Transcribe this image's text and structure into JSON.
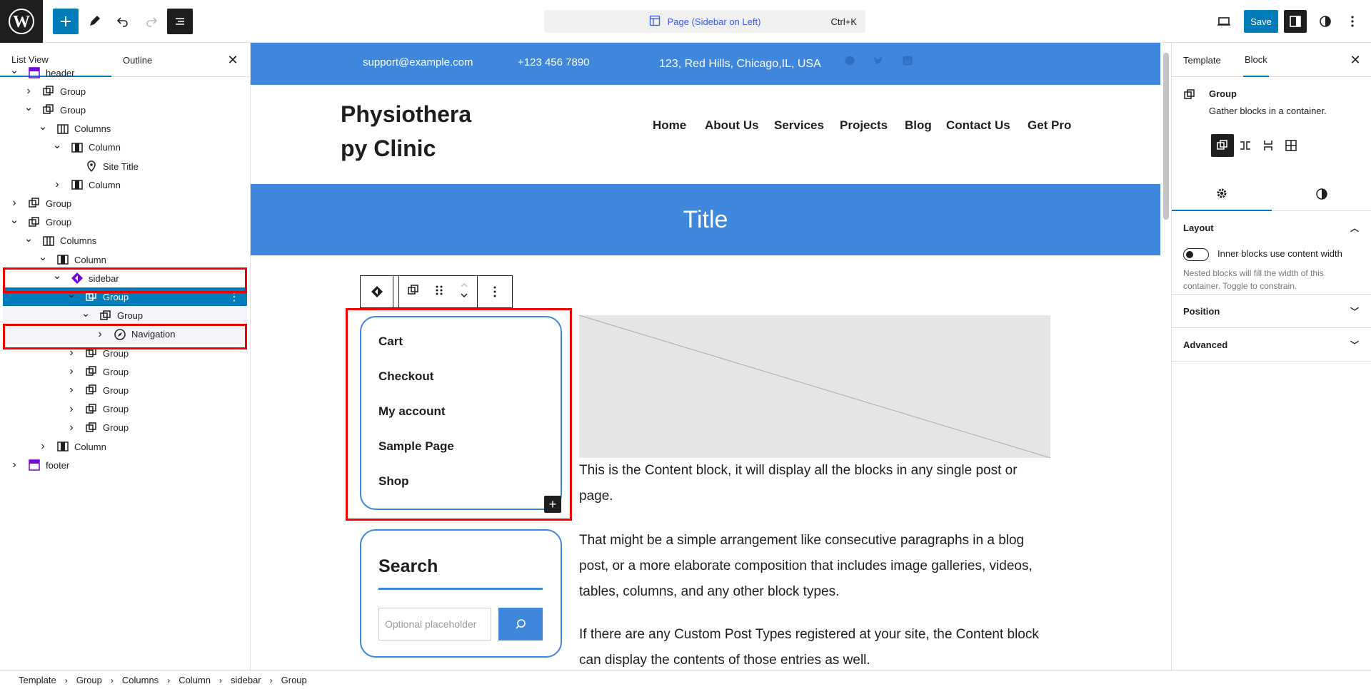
{
  "topbar": {
    "doc_title": "Page (Sidebar on Left)",
    "shortcut": "Ctrl+K",
    "save_label": "Save"
  },
  "left_panel": {
    "tabs": [
      "List View",
      "Outline"
    ],
    "tree": [
      {
        "label": "header",
        "depth": 0,
        "expanded": true,
        "icon": "template-part-icon"
      },
      {
        "label": "Group",
        "depth": 1,
        "expanded": false,
        "icon": "group-icon"
      },
      {
        "label": "Group",
        "depth": 1,
        "expanded": true,
        "icon": "group-icon"
      },
      {
        "label": "Columns",
        "depth": 2,
        "expanded": true,
        "icon": "columns-icon"
      },
      {
        "label": "Column",
        "depth": 3,
        "expanded": true,
        "icon": "column-icon"
      },
      {
        "label": "Site Title",
        "depth": 4,
        "expanded": null,
        "icon": "map-pin-icon"
      },
      {
        "label": "Column",
        "depth": 3,
        "expanded": false,
        "icon": "column-icon"
      },
      {
        "label": "Group",
        "depth": 0,
        "expanded": false,
        "icon": "group-icon"
      },
      {
        "label": "Group",
        "depth": 0,
        "expanded": true,
        "icon": "group-icon"
      },
      {
        "label": "Columns",
        "depth": 1,
        "expanded": true,
        "icon": "columns-icon"
      },
      {
        "label": "Column",
        "depth": 2,
        "expanded": true,
        "icon": "column-icon"
      },
      {
        "label": "sidebar",
        "depth": 3,
        "expanded": true,
        "icon": "synced-pattern-icon"
      },
      {
        "label": "Group",
        "depth": 4,
        "expanded": true,
        "icon": "group-icon"
      },
      {
        "label": "Group",
        "depth": 5,
        "expanded": true,
        "icon": "group-icon"
      },
      {
        "label": "Navigation",
        "depth": 6,
        "expanded": false,
        "icon": "compass-icon"
      },
      {
        "label": "Group",
        "depth": 4,
        "expanded": false,
        "icon": "group-icon"
      },
      {
        "label": "Group",
        "depth": 4,
        "expanded": false,
        "icon": "group-icon"
      },
      {
        "label": "Group",
        "depth": 4,
        "expanded": false,
        "icon": "group-icon"
      },
      {
        "label": "Group",
        "depth": 4,
        "expanded": false,
        "icon": "group-icon"
      },
      {
        "label": "Group",
        "depth": 4,
        "expanded": false,
        "icon": "group-icon"
      },
      {
        "label": "Column",
        "depth": 2,
        "expanded": false,
        "icon": "column-icon"
      },
      {
        "label": "footer",
        "depth": 0,
        "expanded": false,
        "icon": "template-part-icon"
      }
    ]
  },
  "canvas": {
    "email": "support@example.com",
    "phone": "+123 456 7890",
    "address": "123, Red Hills, Chicago,IL, USA",
    "site_title": "Physiotherapy Clinic",
    "site_title_line1": "Physiothera",
    "site_title_line2": "py Clinic",
    "nav": [
      "Home",
      "About Us",
      "Services",
      "Projects",
      "Blog",
      "Contact Us",
      "Get Pro"
    ],
    "banner_title": "Title",
    "sidebar_menu": [
      "Cart",
      "Checkout",
      "My account",
      "Sample Page",
      "Shop"
    ],
    "search_title": "Search",
    "search_placeholder": "Optional placeholder",
    "paragraphs": [
      "This is the Content block, it will display all the blocks in any single post or page.",
      "That might be a simple arrangement like consecutive paragraphs in a blog post, or a more elaborate composition that includes image galleries, videos, tables, columns, and any other block types.",
      "If there are any Custom Post Types registered at your site, the Content block can display the contents of those entries as well."
    ],
    "accent_color": "#3f86dd"
  },
  "right_panel": {
    "tabs": [
      "Template",
      "Block"
    ],
    "block_name": "Group",
    "block_desc": "Gather blocks in a container.",
    "layout_label": "Layout",
    "toggle_label": "Inner blocks use content width",
    "help_text": "Nested blocks will fill the width of this container. Toggle to constrain.",
    "position_label": "Position",
    "advanced_label": "Advanced"
  },
  "breadcrumb": [
    "Template",
    "Group",
    "Columns",
    "Column",
    "sidebar",
    "Group"
  ],
  "colors": {
    "wp_blue": "#007cba",
    "highlight_red": "#e00000",
    "purple": "#7a00df"
  }
}
